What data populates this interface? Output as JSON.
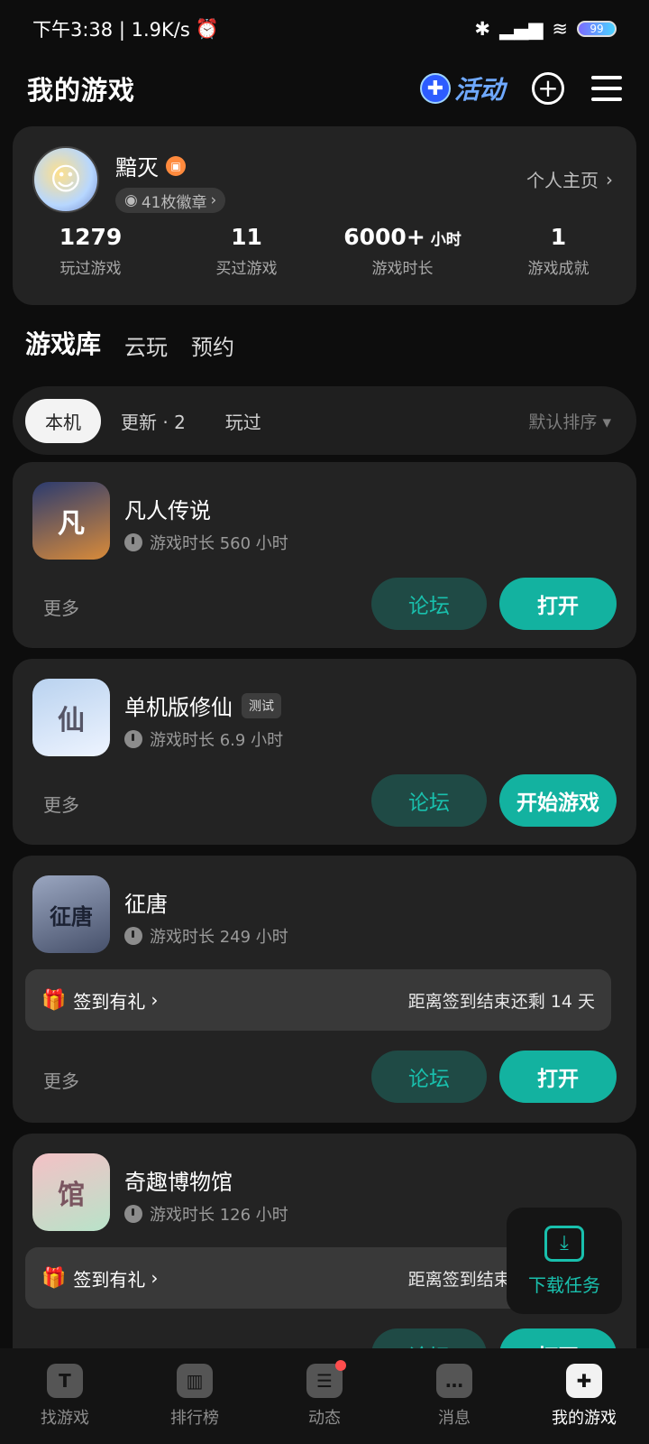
{
  "status_bar": {
    "left_text": "下午3:38 | 1.9K/s",
    "alarm_icon": "alarm-icon",
    "battery": "99",
    "icons": [
      "bluetooth-icon",
      "signal-icon",
      "wifi-icon",
      "battery-icon"
    ]
  },
  "header": {
    "title": "我的游戏",
    "activity_label": "活动",
    "add_icon": "plus-circle-icon",
    "menu_icon": "menu-icon"
  },
  "profile": {
    "username": "黯灭",
    "badges": "41枚徽章",
    "profile_link": "个人主页",
    "stats": [
      {
        "value": "1279",
        "unit": "",
        "label": "玩过游戏"
      },
      {
        "value": "11",
        "unit": "",
        "label": "买过游戏"
      },
      {
        "value": "6000+",
        "unit": "小时",
        "label": "游戏时长"
      },
      {
        "value": "1",
        "unit": "",
        "label": "游戏成就"
      }
    ]
  },
  "tabs": [
    "游戏库",
    "云玩",
    "预约"
  ],
  "filters": {
    "chips": [
      "本机",
      "更新 · 2",
      "玩过"
    ],
    "sort": "默认排序"
  },
  "games": [
    {
      "title": "凡人传说",
      "tag": "",
      "playtime": "游戏时长 560 小时",
      "more": "更多",
      "forum": "论坛",
      "action": "打开",
      "icon_colors": [
        "#2b3b6f",
        "#d98b3a"
      ],
      "icon_text": "凡"
    },
    {
      "title": "单机版修仙",
      "tag": "测试",
      "playtime": "游戏时长 6.9 小时",
      "more": "更多",
      "forum": "论坛",
      "action": "开始游戏",
      "icon_colors": [
        "#b9d2ef",
        "#eef4ff"
      ],
      "icon_text": "仙"
    },
    {
      "title": "征唐",
      "tag": "",
      "playtime": "游戏时长 249 小时",
      "more": "更多",
      "forum": "论坛",
      "action": "打开",
      "signin_label": "签到有礼",
      "signin_remaining": "距离签到结束还剩 14 天",
      "icon_colors": [
        "#9aa6c0",
        "#46506a"
      ],
      "icon_text": "征唐"
    },
    {
      "title": "奇趣博物馆",
      "tag": "",
      "playtime": "游戏时长 126 小时",
      "more": "更多",
      "forum": "论坛",
      "action": "打开",
      "signin_label": "签到有礼",
      "signin_remaining": "距离签到结束还剩 14 天",
      "icon_colors": [
        "#f4c1c6",
        "#b8e3c9"
      ],
      "icon_text": "馆"
    }
  ],
  "download_fab": {
    "label": "下载任务",
    "icon": "download-icon"
  },
  "bottom_nav": [
    {
      "label": "找游戏",
      "icon": "t-icon",
      "active": false
    },
    {
      "label": "排行榜",
      "icon": "ranking-icon",
      "active": false
    },
    {
      "label": "动态",
      "icon": "feed-icon",
      "active": false,
      "dot": true
    },
    {
      "label": "消息",
      "icon": "message-icon",
      "active": false
    },
    {
      "label": "我的游戏",
      "icon": "gamepad-icon",
      "active": true
    }
  ],
  "colors": {
    "accent": "#13b2a0",
    "card": "#232323",
    "background": "#0d0d0d"
  }
}
